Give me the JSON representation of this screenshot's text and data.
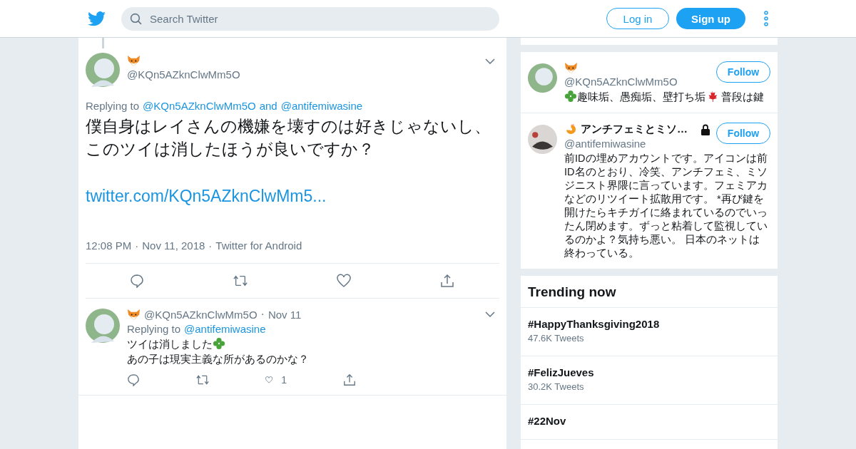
{
  "header": {
    "search": {
      "placeholder": "Search Twitter"
    },
    "login": "Log in",
    "signup": "Sign up"
  },
  "main_tweet": {
    "handle": "@KQn5AZknClwMm5O",
    "replying_label": "Replying to",
    "replying_to": [
      "@KQn5AZknClwMm5O",
      "@antifemiwasine"
    ],
    "replying_join": "and",
    "lines": [
      "僕自身はレイさんの機嫌を壊すのは好きじゃないし、",
      "このツイは消したほうが良いですか？"
    ],
    "link": "twitter.com/KQn5AZknClwMm5...",
    "meta": [
      "12:08 PM",
      "Nov 11, 2018",
      "Twitter for Android"
    ],
    "meta_separator": "·"
  },
  "replies": [
    {
      "handle": "@KQn5AZknClwMm5O",
      "separator": "·",
      "time": "Nov 11",
      "replying_label": "Replying to",
      "replying_to": "@antifemiwasine",
      "segments": [
        {
          "kind": "text",
          "text": "ツイは消しました"
        },
        {
          "kind": "clover"
        },
        {
          "kind": "break"
        },
        {
          "kind": "text",
          "text": "あの子は現実主義な所があるのかな？"
        }
      ],
      "likes": "1"
    }
  ],
  "who_to_follow": [
    {
      "kind": "fox",
      "locked": false,
      "handle": "@KQn5AZknClwMm5O",
      "button": "Follow",
      "bio": [
        {
          "kind": "clover"
        },
        {
          "kind": "text",
          "text": "趣味垢、愚痴垢、壁打ち垢"
        },
        {
          "kind": "maple"
        },
        {
          "kind": "text",
          "text": " 普段は鍵"
        }
      ]
    },
    {
      "kind": "shrimp",
      "name": "アンチフェミとミソ…",
      "locked": true,
      "handle": "@antifemiwasine",
      "button": "Follow",
      "bio": [
        {
          "kind": "text",
          "text": "前IDの埋めアカウントです。アイコンは前ID名のとおり、冷笑、アンチフェミ、ミソジニスト界隈に言っています。フェミアカなどのリツイート拡散用です。 *再び鍵を開けたらキチガイに絡まれているのでいったん閉めます。ずっと粘着して監視しているのかよ？気持ち悪い。 日本のネットは終わっている。"
        }
      ]
    }
  ],
  "trending": {
    "title": "Trending now",
    "items": [
      {
        "tag": "#HappyThanksgiving2018",
        "count": "47.6K Tweets"
      },
      {
        "tag": "#FelizJueves",
        "count": "30.2K Tweets"
      },
      {
        "tag": "#22Nov"
      }
    ]
  }
}
